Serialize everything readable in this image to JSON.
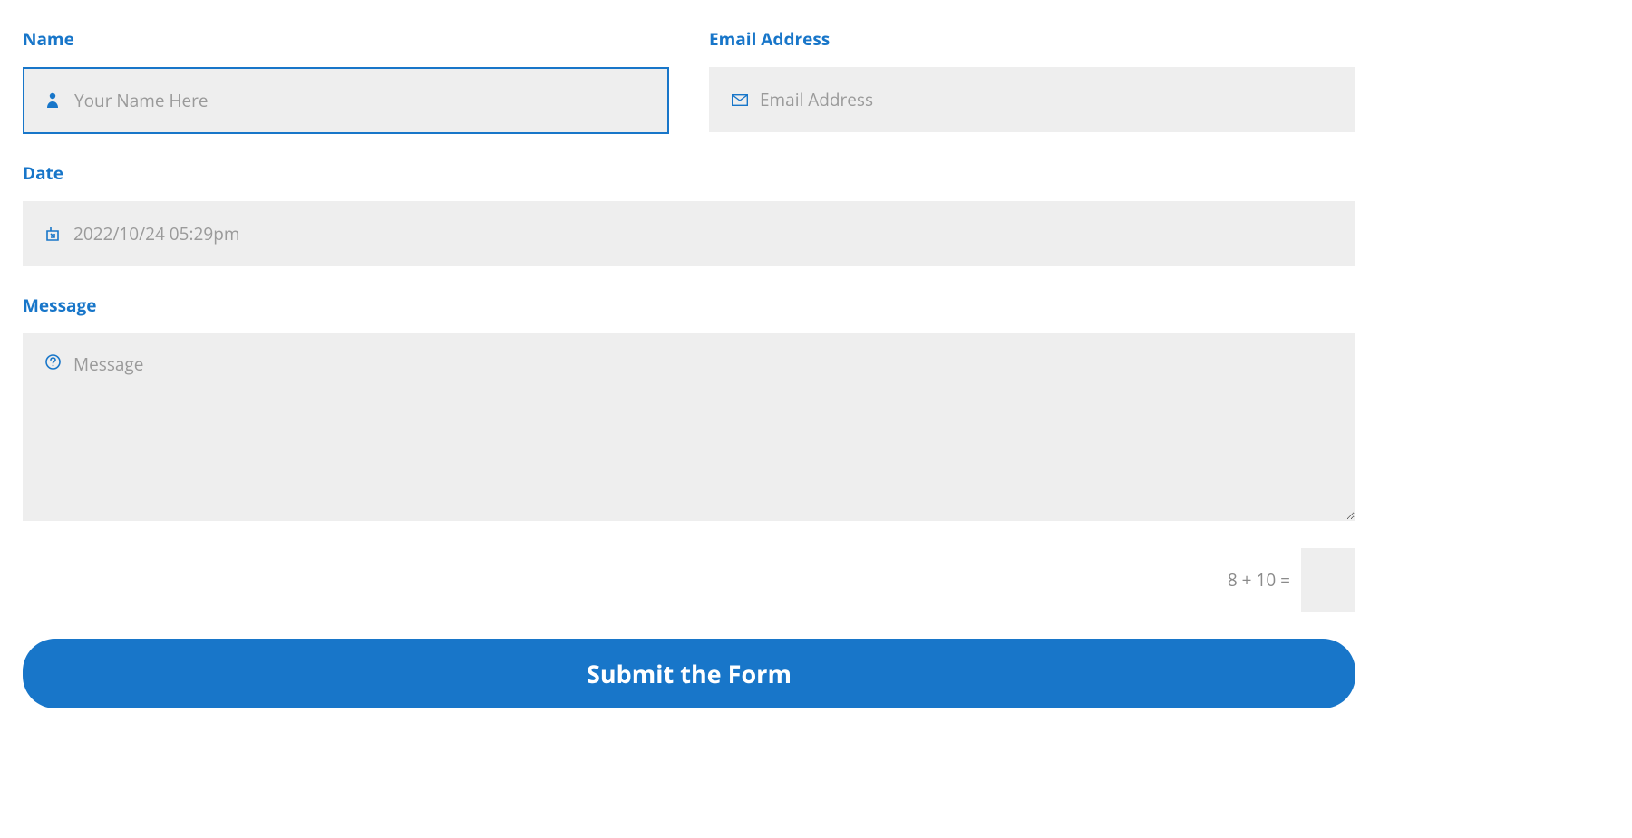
{
  "form": {
    "name": {
      "label": "Name",
      "placeholder": "Your Name Here",
      "value": ""
    },
    "email": {
      "label": "Email Address",
      "placeholder": "Email Address",
      "value": ""
    },
    "date": {
      "label": "Date",
      "placeholder": "2022/10/24 05:29pm",
      "value": ""
    },
    "message": {
      "label": "Message",
      "placeholder": "Message",
      "value": ""
    },
    "captcha": {
      "question": "8 + 10 =",
      "value": ""
    },
    "submit_label": "Submit the Form"
  },
  "colors": {
    "primary": "#1876c9",
    "input_bg": "#eeeeee",
    "placeholder": "#9a9a9a"
  }
}
